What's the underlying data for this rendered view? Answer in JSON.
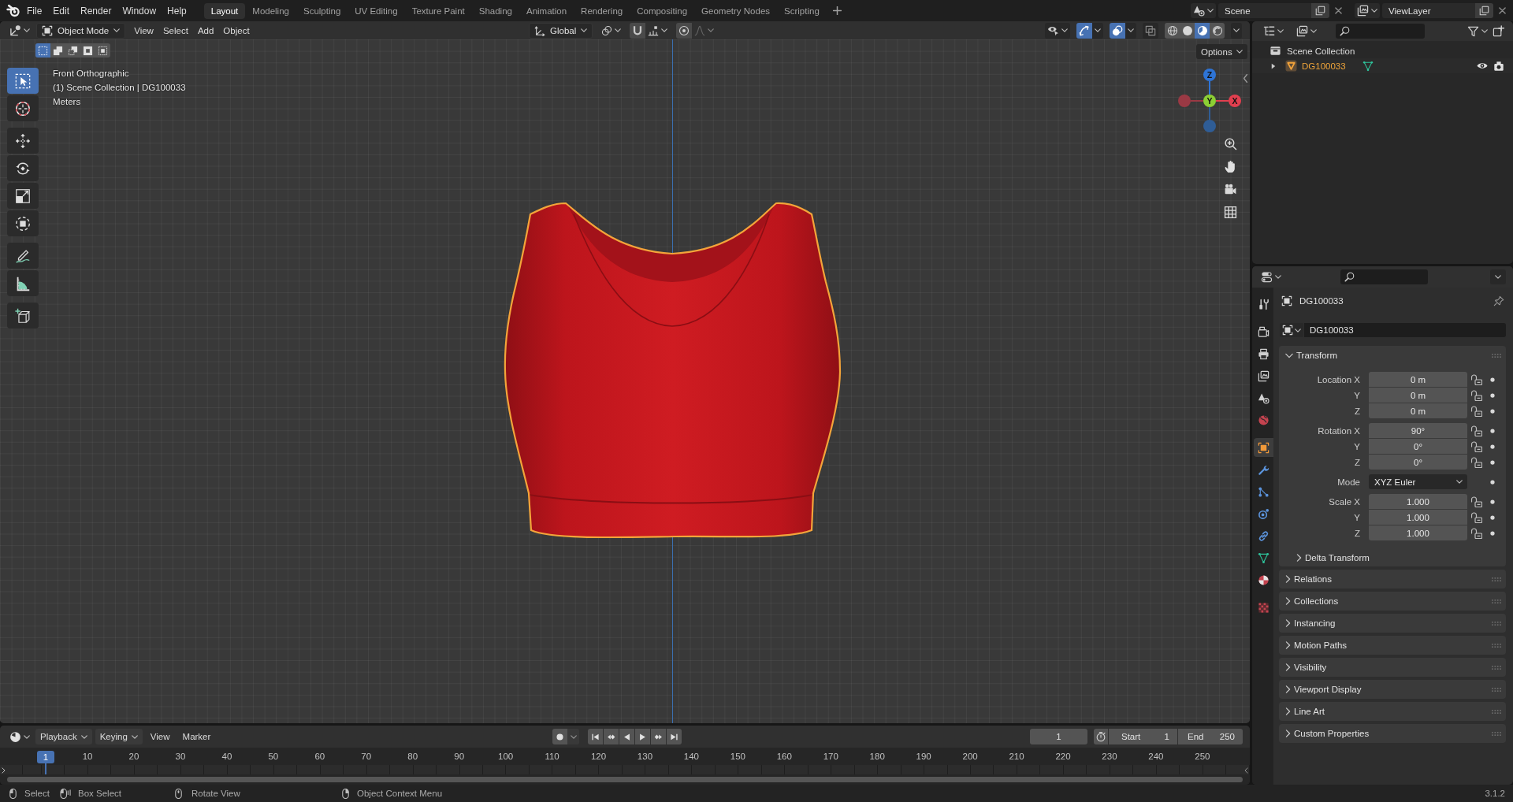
{
  "top_bar": {
    "menus": [
      "File",
      "Edit",
      "Render",
      "Window",
      "Help"
    ],
    "workspaces": [
      {
        "label": "Layout",
        "selected": true
      },
      {
        "label": "Modeling",
        "selected": false
      },
      {
        "label": "Sculpting",
        "selected": false
      },
      {
        "label": "UV Editing",
        "selected": false
      },
      {
        "label": "Texture Paint",
        "selected": false
      },
      {
        "label": "Shading",
        "selected": false
      },
      {
        "label": "Animation",
        "selected": false
      },
      {
        "label": "Rendering",
        "selected": false
      },
      {
        "label": "Compositing",
        "selected": false
      },
      {
        "label": "Geometry Nodes",
        "selected": false
      },
      {
        "label": "Scripting",
        "selected": false
      }
    ],
    "scene": "Scene",
    "view_layer": "ViewLayer"
  },
  "viewport": {
    "mode": "Object Mode",
    "menus": [
      "View",
      "Select",
      "Add",
      "Object"
    ],
    "orientation": "Global",
    "shading": [
      {
        "kind": "wireframe",
        "selected": false
      },
      {
        "kind": "solid",
        "selected": false
      },
      {
        "kind": "material",
        "selected": true
      },
      {
        "kind": "rendered",
        "selected": false
      }
    ],
    "select_modes": [
      {
        "kind": "set",
        "selected": true
      },
      {
        "kind": "extend",
        "selected": false
      },
      {
        "kind": "subtract",
        "selected": false
      },
      {
        "kind": "invert",
        "selected": false
      },
      {
        "kind": "intersect",
        "selected": false
      }
    ],
    "tools": [
      {
        "kind": "select",
        "selected": true
      },
      {
        "kind": "cursor",
        "selected": false
      },
      {
        "kind": "move",
        "selected": false
      },
      {
        "kind": "rotate",
        "selected": false
      },
      {
        "kind": "scale",
        "selected": false
      },
      {
        "kind": "transform",
        "selected": false
      },
      {
        "kind": "annotate",
        "selected": false
      },
      {
        "kind": "measure",
        "selected": false
      },
      {
        "kind": "cube",
        "selected": false
      }
    ],
    "overlay_text": [
      "Front Orthographic",
      "(1) Scene Collection | DG100033",
      "Meters"
    ],
    "options": "Options",
    "gizmo": [
      {
        "kind": "top",
        "label": "Z",
        "color": "#2e74d6"
      },
      {
        "kind": "left",
        "color": "#9a3944"
      },
      {
        "kind": "bottom",
        "color": "#2f5d96"
      },
      {
        "kind": "center",
        "label": "Y",
        "color": "#8ccf34"
      },
      {
        "kind": "right",
        "label": "X",
        "color": "#e23f4f"
      }
    ]
  },
  "outliner": {
    "tree": [
      {
        "label": "Scene Collection",
        "children": [
          {
            "label": "DG100033",
            "expanded": false,
            "active": true
          }
        ]
      }
    ]
  },
  "properties": {
    "tabs": [
      {
        "kind": "tool",
        "selected": false
      },
      {
        "kind": "render",
        "selected": false
      },
      {
        "kind": "output",
        "selected": false
      },
      {
        "kind": "viewlayer",
        "selected": false
      },
      {
        "kind": "scene",
        "selected": false
      },
      {
        "kind": "world",
        "selected": false
      },
      {
        "kind": "object",
        "selected": true
      },
      {
        "kind": "modifiers",
        "selected": false
      },
      {
        "kind": "particles",
        "selected": false
      },
      {
        "kind": "physics",
        "selected": false
      },
      {
        "kind": "constraints",
        "selected": false
      },
      {
        "kind": "data",
        "selected": false
      },
      {
        "kind": "material",
        "selected": false
      },
      {
        "kind": "texture",
        "selected": false
      }
    ],
    "context": "DG100033",
    "name": "DG100033",
    "transform": {
      "label": "Transform",
      "expanded": true,
      "groups": [
        {
          "rows": [
            {
              "kind": "number",
              "label": "Location X",
              "value": "0 m",
              "locked": false
            },
            {
              "kind": "number",
              "label": "Y",
              "value": "0 m",
              "locked": false
            },
            {
              "kind": "number",
              "label": "Z",
              "value": "0 m",
              "locked": false
            }
          ]
        },
        {
          "rows": [
            {
              "kind": "number",
              "label": "Rotation X",
              "value": "90°",
              "locked": false
            },
            {
              "kind": "number",
              "label": "Y",
              "value": "0°",
              "locked": false
            },
            {
              "kind": "number",
              "label": "Z",
              "value": "0°",
              "locked": false
            }
          ]
        },
        {
          "rows": [
            {
              "kind": "dropdown",
              "label": "Mode",
              "value": "XYZ Euler"
            }
          ]
        },
        {
          "rows": [
            {
              "kind": "number",
              "label": "Scale X",
              "value": "1.000",
              "locked": false
            },
            {
              "kind": "number",
              "label": "Y",
              "value": "1.000",
              "locked": false
            },
            {
              "kind": "number",
              "label": "Z",
              "value": "1.000",
              "locked": false
            }
          ]
        }
      ],
      "subpanels": [
        {
          "label": "Delta Transform",
          "expanded": false
        }
      ]
    },
    "panels": [
      {
        "label": "Relations",
        "expanded": false
      },
      {
        "label": "Collections",
        "expanded": false
      },
      {
        "label": "Instancing",
        "expanded": false
      },
      {
        "label": "Motion Paths",
        "expanded": false
      },
      {
        "label": "Visibility",
        "expanded": false
      },
      {
        "label": "Viewport Display",
        "expanded": false
      },
      {
        "label": "Line Art",
        "expanded": false
      },
      {
        "label": "Custom Properties",
        "expanded": false
      }
    ]
  },
  "timeline": {
    "menus": [
      {
        "label": "Playback",
        "kind": "dropdown"
      },
      {
        "label": "Keying",
        "kind": "dropdown"
      },
      {
        "label": "View",
        "kind": "menu"
      },
      {
        "label": "Marker",
        "kind": "menu"
      }
    ],
    "current_frame": "1",
    "start_label": "Start",
    "start": "1",
    "end_label": "End",
    "end": "250",
    "playhead": {
      "label": "1",
      "level": 0
    },
    "ruler": [
      "10",
      "20",
      "30",
      "40",
      "50",
      "60",
      "70",
      "80",
      "90",
      "100",
      "110",
      "120",
      "130",
      "140",
      "150",
      "160",
      "170",
      "180",
      "190",
      "200",
      "210",
      "220",
      "230",
      "240",
      "250"
    ]
  },
  "status_bar": {
    "hints": [
      {
        "kind": "left",
        "label": "Select"
      },
      {
        "kind": "drag",
        "label": "Box Select"
      },
      {
        "kind": "middle",
        "label": "Rotate View"
      },
      {
        "kind": "right",
        "label": "Object Context Menu"
      }
    ],
    "version": "3.1.2"
  }
}
